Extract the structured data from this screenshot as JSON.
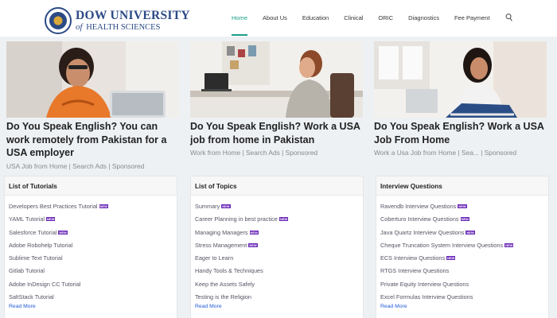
{
  "header": {
    "logo_line1": "DOW UNIVERSITY",
    "logo_line2_of": "of",
    "logo_line2": "HEALTH SCIENCES",
    "nav": [
      "Home",
      "About Us",
      "Education",
      "Clinical",
      "ORIC",
      "Diagnostics",
      "Fee Payment"
    ],
    "active_nav": "Home",
    "accent_color": "#1a9f8a"
  },
  "ads": [
    {
      "title": "Do You Speak English? You can work remotely from Pakistan for a USA employer",
      "meta": "USA Job from Home | Search Ads | Sponsored"
    },
    {
      "title": "Do You Speak English? Work a USA job from home in Pakistan",
      "meta": "Work from Home | Search Ads | Sponsored"
    },
    {
      "title": "Do You Speak English? Work a USA Job From Home",
      "meta": "Work a Usa Job from Home | Sea... | Sponsored"
    }
  ],
  "badge_text": "NEW",
  "cards": [
    {
      "title": "List of Tutorials",
      "items": [
        {
          "label": "Developers Best Practices Tutorial",
          "new": true
        },
        {
          "label": "YAML Tutorial",
          "new": true
        },
        {
          "label": "Salesforce Tutorial",
          "new": true
        },
        {
          "label": "Adobe Robohelp Tutorial",
          "new": false
        },
        {
          "label": "Sublime Text Tutorial",
          "new": false
        },
        {
          "label": "Gitlab Tutorial",
          "new": false
        },
        {
          "label": "Adobe InDesign CC Tutorial",
          "new": false
        },
        {
          "label": "SaltStack Tutorial",
          "new": false
        }
      ],
      "read_more": "Read More"
    },
    {
      "title": "List of Topics",
      "items": [
        {
          "label": "Summary",
          "new": true
        },
        {
          "label": "Career Planning in best practice",
          "new": true
        },
        {
          "label": "Managing Managers",
          "new": true
        },
        {
          "label": "Stress Management",
          "new": true
        },
        {
          "label": "Eager to Learn",
          "new": false
        },
        {
          "label": "Handy Tools & Techniques",
          "new": false
        },
        {
          "label": "Keep the Assets Safely",
          "new": false
        },
        {
          "label": "Testing is the Religion",
          "new": false
        }
      ],
      "read_more": "Read More"
    },
    {
      "title": "Interview Questions",
      "items": [
        {
          "label": "Ravendb Interview Questions",
          "new": true
        },
        {
          "label": "Coberturo Interview Questions",
          "new": true
        },
        {
          "label": "Java Quartz Interview Questions",
          "new": true
        },
        {
          "label": "Cheque Truncation System Interview Questions",
          "new": true
        },
        {
          "label": "ECS Interview Questions",
          "new": true
        },
        {
          "label": "RTGS Interview Questions",
          "new": false
        },
        {
          "label": "Private Equity Interview Questions",
          "new": false
        },
        {
          "label": "Excel Formulas Interview Questions",
          "new": false
        }
      ],
      "read_more": "Read More"
    }
  ]
}
